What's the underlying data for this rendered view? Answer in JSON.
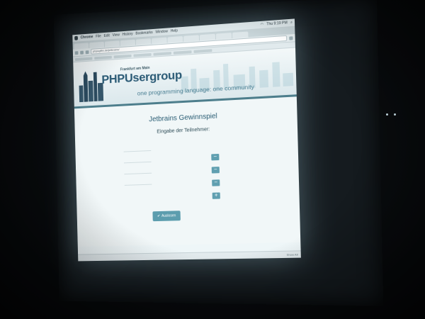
{
  "browser": {
    "app_name": "Chrome",
    "menu_items": [
      "File",
      "Edit",
      "View",
      "History",
      "Bookmarks",
      "Window",
      "Help"
    ],
    "clock": "Thu 9:19 PM",
    "url": "phpugffm.de/jetbrains/",
    "tabs": [
      "",
      "",
      "",
      "",
      "",
      "",
      "",
      "",
      "",
      "",
      ""
    ],
    "download_status": "Show All"
  },
  "site": {
    "city_caption": "Frankfurt am Main",
    "logo_php": "PHP",
    "logo_usergroup": "Usergroup",
    "tagline": "one programming language: one community"
  },
  "page": {
    "title": "Jetbrains Gewinnspiel",
    "subtitle": "Eingabe der Teilnehmer:",
    "draw_button_label": "Auslosen"
  },
  "colors": {
    "accent": "#5f9fb0",
    "brand": "#2a5a75",
    "screen_glow": "#eef6f8"
  },
  "icons": [
    "apple-icon",
    "wifi-icon",
    "minus-icon",
    "plus-icon",
    "check-icon"
  ]
}
